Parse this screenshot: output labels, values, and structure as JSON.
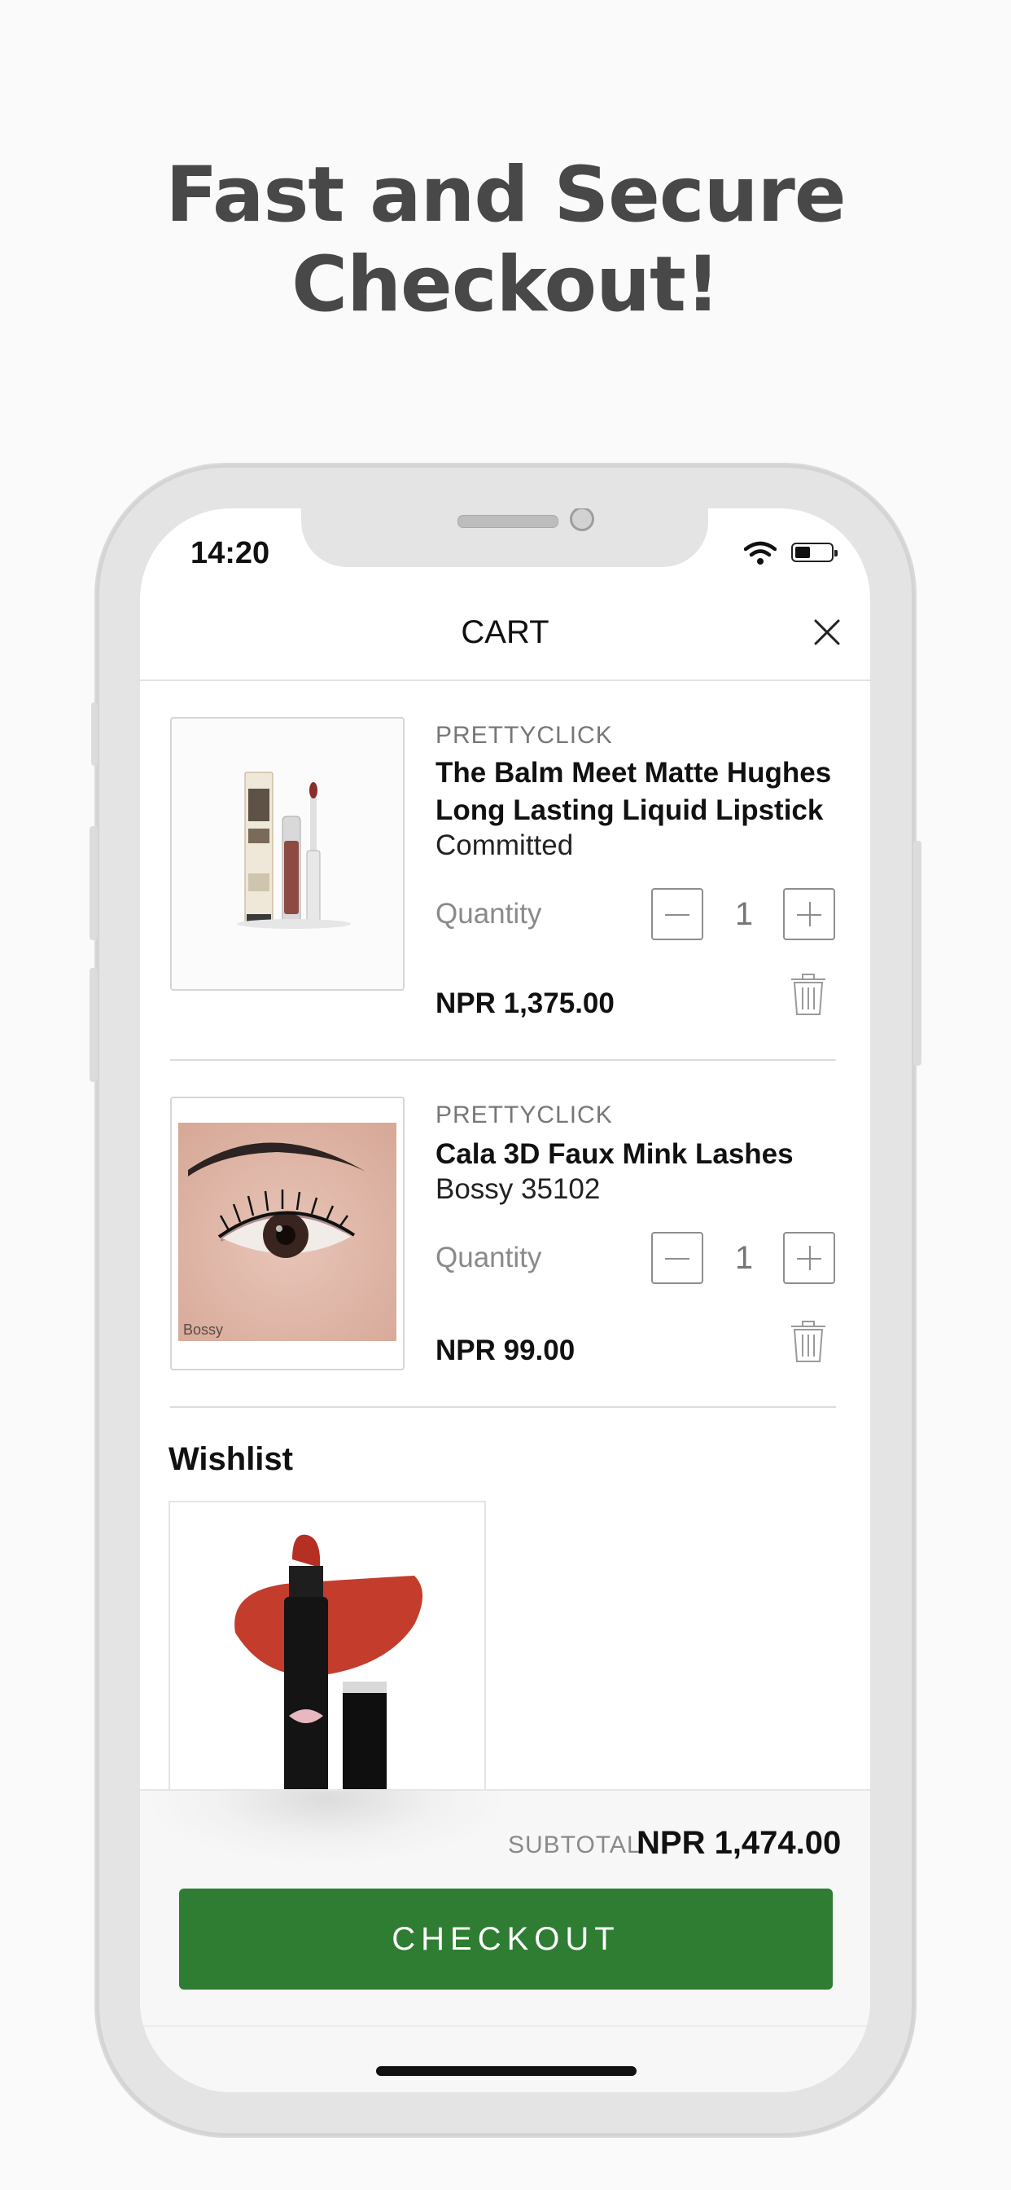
{
  "promo": {
    "line1": "Fast and Secure",
    "line2": "Checkout!"
  },
  "status_bar": {
    "time": "14:20",
    "wifi_icon": "wifi-icon",
    "battery_icon": "battery-icon"
  },
  "header": {
    "title": "CART",
    "close_icon": "close-icon"
  },
  "cart": {
    "items": [
      {
        "brand": "PRETTYCLICK",
        "name_line1": "The Balm Meet Matte Hughes",
        "name_line2": "Long Lasting Liquid Lipstick",
        "variant": "Committed",
        "quantity_label": "Quantity",
        "quantity": "1",
        "price": "NPR 1,375.00"
      },
      {
        "brand": "PRETTYCLICK",
        "name_line1": "Cala 3D Faux Mink Lashes",
        "variant": "Bossy 35102",
        "quantity_label": "Quantity",
        "quantity": "1",
        "price": "NPR 99.00",
        "image_caption": "Bossy"
      }
    ]
  },
  "wishlist": {
    "title": "Wishlist"
  },
  "footer": {
    "subtotal_label": "SUBTOTAL",
    "subtotal_value": "NPR 1,474.00",
    "checkout_label": "CHECKOUT",
    "checkout_color": "#2e7d32"
  }
}
